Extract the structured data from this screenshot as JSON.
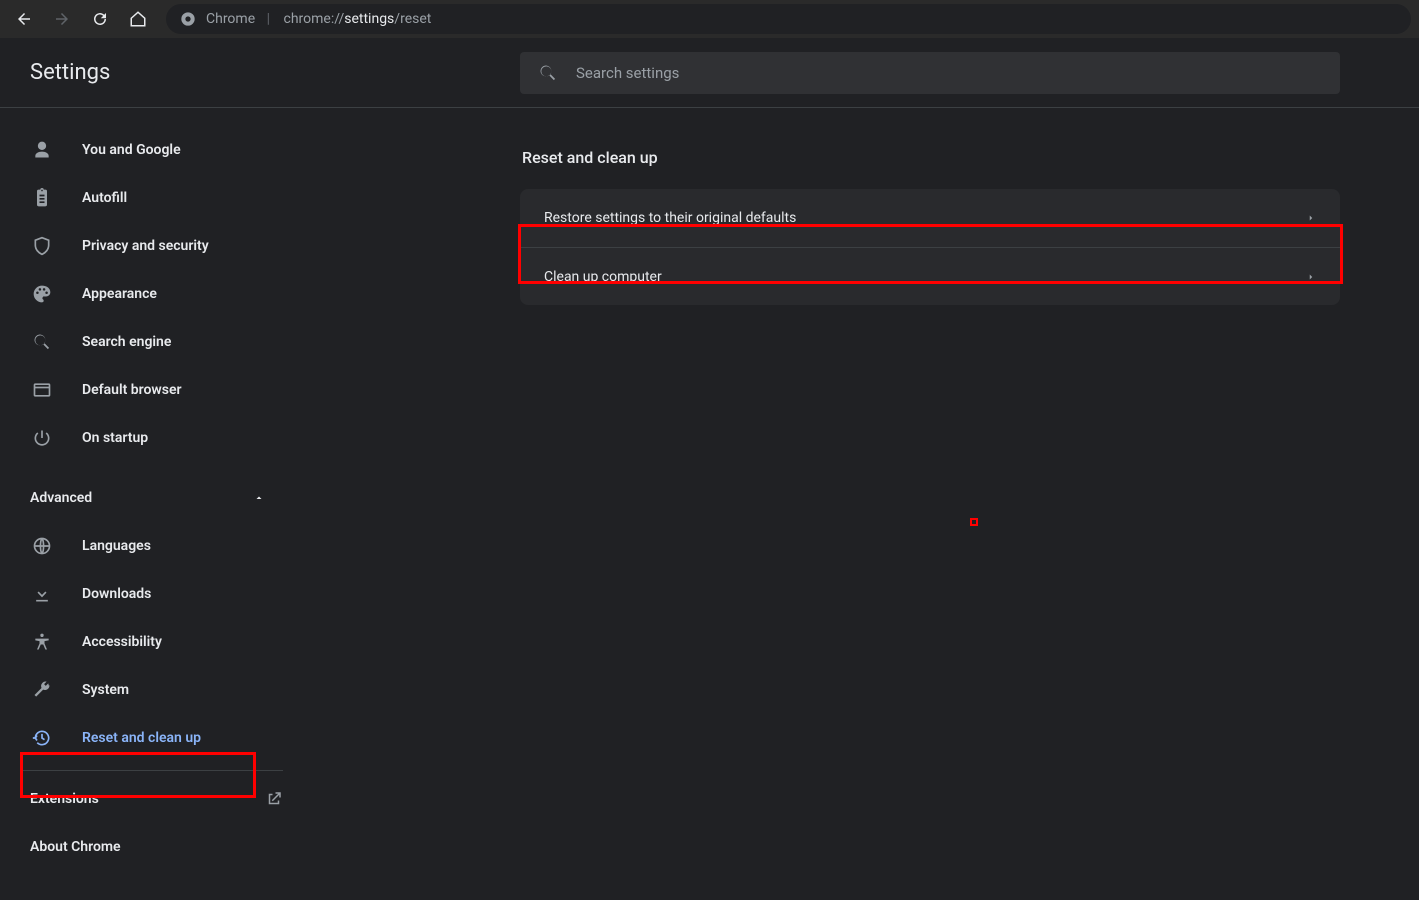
{
  "toolbar": {
    "origin_label": "Chrome",
    "url_prefix": "chrome://",
    "url_bold": "settings",
    "url_suffix": "/reset"
  },
  "header": {
    "title": "Settings",
    "search_placeholder": "Search settings"
  },
  "sidebar": {
    "items_basic": [
      {
        "label": "You and Google",
        "icon": "person-icon"
      },
      {
        "label": "Autofill",
        "icon": "clipboard-icon"
      },
      {
        "label": "Privacy and security",
        "icon": "shield-icon"
      },
      {
        "label": "Appearance",
        "icon": "palette-icon"
      },
      {
        "label": "Search engine",
        "icon": "search-icon"
      },
      {
        "label": "Default browser",
        "icon": "browser-icon"
      },
      {
        "label": "On startup",
        "icon": "power-icon"
      }
    ],
    "advanced_label": "Advanced",
    "items_advanced": [
      {
        "label": "Languages",
        "icon": "globe-icon"
      },
      {
        "label": "Downloads",
        "icon": "download-icon"
      },
      {
        "label": "Accessibility",
        "icon": "accessibility-icon"
      },
      {
        "label": "System",
        "icon": "wrench-icon"
      },
      {
        "label": "Reset and clean up",
        "icon": "history-icon",
        "selected": true
      }
    ],
    "extensions_label": "Extensions",
    "about_label": "About Chrome"
  },
  "main": {
    "section_title": "Reset and clean up",
    "rows": [
      {
        "label": "Restore settings to their original defaults"
      },
      {
        "label": "Clean up computer"
      }
    ]
  }
}
